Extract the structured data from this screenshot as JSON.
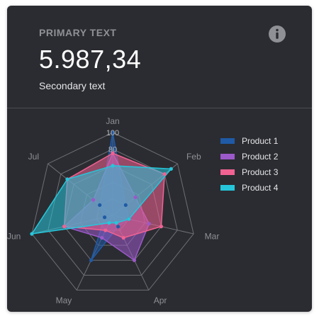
{
  "header": {
    "primary_text": "PRIMARY TEXT",
    "value": "5.987,34",
    "secondary_text": "Secondary text",
    "info_icon": "info-icon"
  },
  "chart_data": {
    "type": "radar",
    "categories": [
      "Jan",
      "Feb",
      "Mar",
      "Apr",
      "May",
      "Jun",
      "Jul"
    ],
    "rlim": [
      0,
      100
    ],
    "tick_labels": [
      "100",
      "80"
    ],
    "grid": true,
    "legend_position": "right",
    "series": [
      {
        "name": "Product 1",
        "color": "#1f5aa6",
        "values": [
          100,
          20,
          20,
          15,
          60,
          10,
          20
        ]
      },
      {
        "name": "Product 2",
        "color": "#9b59c9",
        "values": [
          75,
          35,
          45,
          60,
          30,
          60,
          30
        ]
      },
      {
        "name": "Product 3",
        "color": "#f06292",
        "values": [
          75,
          80,
          60,
          30,
          20,
          60,
          70
        ]
      },
      {
        "name": "Product 4",
        "color": "#26c6da",
        "values": [
          60,
          90,
          20,
          10,
          10,
          100,
          70
        ]
      }
    ]
  }
}
